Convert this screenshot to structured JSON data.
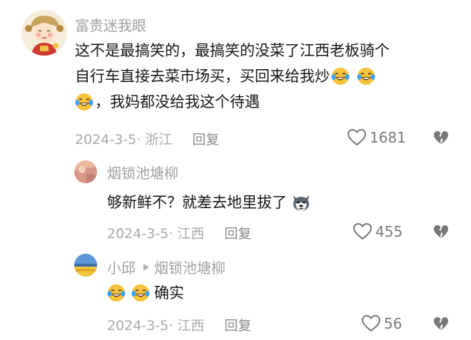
{
  "comments": [
    {
      "username": "富贵迷我眼",
      "lines": [
        [
          "这不是最搞笑的，最搞笑的没菜了江西老板骑个"
        ],
        [
          "自行车直接去菜市场买，买回来给我炒",
          "[laugh-cry-emoji]",
          "[laugh-cry-emoji]"
        ],
        [
          "[laugh-cry-emoji]",
          "，我妈都没给我这个待遇"
        ]
      ],
      "line_1": "这不是最搞笑的，最搞笑的没菜了江西老板骑个",
      "line_2": "自行车直接去菜市场买，买回来给我炒",
      "line_3": "，我妈都没给我这个待遇",
      "date_location": "2024-3-5· 浙江",
      "reply_label": "回复",
      "like_count": "1681"
    },
    {
      "username": "烟锁池塘柳",
      "line_1": "够新鲜不？就差去地里拔了",
      "date_location": "2024-3-5· 江西",
      "reply_label": "回复",
      "like_count": "455"
    },
    {
      "username": "小邱",
      "reply_to": "烟锁池塘柳",
      "line_1": "确实",
      "date_location": "2024-3-5· 江西",
      "reply_label": "回复",
      "like_count": "56"
    }
  ],
  "icons": {
    "like": "heart-outline-icon",
    "dislike": "broken-heart-icon",
    "emoji": "laugh-cry-emoji",
    "dog": "husky-emoji",
    "reply_arrow": "triangle-right-icon"
  },
  "colors": {
    "username": "#a0a0a0",
    "meta": "#a8a8a8",
    "body": "#161616",
    "emoji_face": "#f7c23c",
    "emoji_tear": "#3aa2f0"
  }
}
